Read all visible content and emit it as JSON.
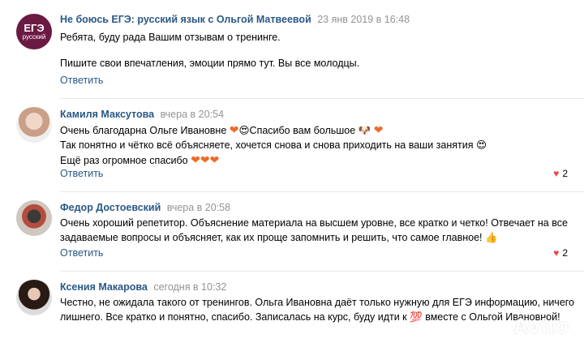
{
  "comments": [
    {
      "author": "Не боюсь ЕГЭ: русский язык с Ольгой Матвеевой",
      "date": "23 янв 2019 в 16:48",
      "avatar_text_top": "ЕГЭ",
      "avatar_text_bottom": "русский",
      "lines": [
        "Ребята, буду рада Вашим отзывам о тренинге.",
        "",
        "Пишите свои впечатления, эмоции прямо тут. Вы все молодцы."
      ],
      "reply_label": "Ответить"
    },
    {
      "author": "Камиля Максутова",
      "date": "вчера в 20:54",
      "lines": [
        "Очень благодарна Ольге Ивановне",
        "Спасибо вам большое",
        "Так понятно и чётко всё объясняете, хочется снова и снова приходить на ваши занятия",
        "Ещё раз огромное спасибо"
      ],
      "reply_label": "Ответить",
      "likes": "2"
    },
    {
      "author": "Федор Достоевский",
      "date": "вчера в 20:58",
      "lines": [
        "Очень хороший репетитор. Объяснение материала на высшем уровне, все кратко и четко! Отвечает на все",
        "задаваемые вопросы и объясняет, как их проще запомнить и решить, что самое главное!"
      ],
      "reply_label": "Ответить",
      "likes": "2"
    },
    {
      "author": "Ксения Макарова",
      "date": "сегодня в 10:32",
      "lines": [
        "Честно, не ожидала такого от тренингов. Ольга Ивановна даёт только нужную для ЕГЭ информацию, ничего",
        "лишнего. Все кратко и понятно, спасибо. Записалась на курс, буду идти к",
        "вместе с Ольгой Ивановной!"
      ],
      "emoji_100": "💯",
      "reply_label": "Ответить"
    }
  ],
  "watermark": "Avito",
  "colors": {
    "link": "#2a5885",
    "date": "#939393",
    "like": "#e64646",
    "divider": "#e7e8ec"
  }
}
